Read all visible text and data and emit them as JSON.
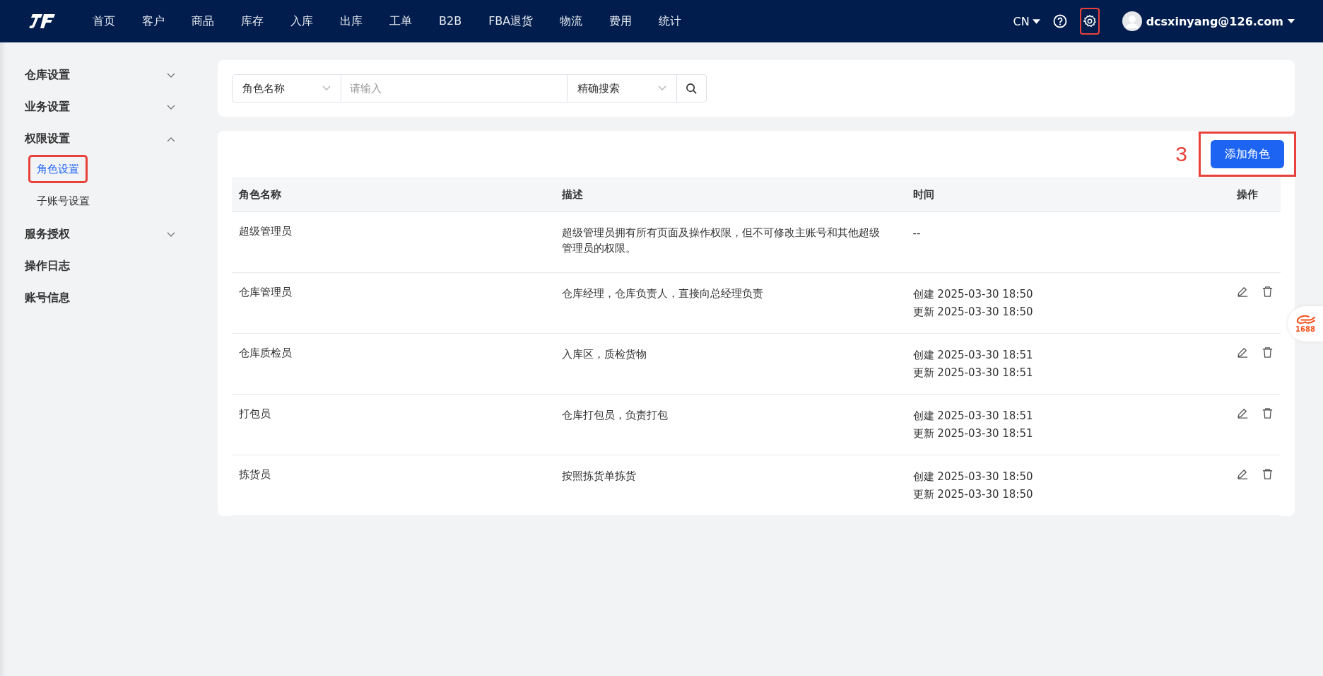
{
  "header": {
    "nav": [
      {
        "label": "首页"
      },
      {
        "label": "客户"
      },
      {
        "label": "商品"
      },
      {
        "label": "库存"
      },
      {
        "label": "入库"
      },
      {
        "label": "出库"
      },
      {
        "label": "工单"
      },
      {
        "label": "B2B"
      },
      {
        "label": "FBA退货"
      },
      {
        "label": "物流"
      },
      {
        "label": "费用"
      },
      {
        "label": "统计"
      }
    ],
    "language": "CN",
    "settings_highlighted": true,
    "user": "dcsxinyang@126.com"
  },
  "sidebar": {
    "items": [
      {
        "label": "仓库设置",
        "expanded": false,
        "has_children": true
      },
      {
        "label": "业务设置",
        "expanded": false,
        "has_children": true
      },
      {
        "label": "权限设置",
        "expanded": true,
        "has_children": true,
        "children": [
          {
            "label": "角色设置",
            "selected": true,
            "highlighted": true
          },
          {
            "label": "子账号设置",
            "selected": false,
            "highlighted": false
          }
        ]
      },
      {
        "label": "服务授权",
        "expanded": false,
        "has_children": true
      },
      {
        "label": "操作日志",
        "has_children": false
      },
      {
        "label": "账号信息",
        "has_children": false
      }
    ]
  },
  "search": {
    "field_select": "角色名称",
    "placeholder": "请输入",
    "mode_select": "精确搜索"
  },
  "toolbar": {
    "annotation": "3",
    "add_button": "添加角色",
    "highlighted": true
  },
  "table": {
    "columns": [
      "角色名称",
      "描述",
      "时间",
      "操作"
    ],
    "rows": [
      {
        "name": "超级管理员",
        "description": "超级管理员拥有所有页面及操作权限，但不可修改主账号和其他超级管理员的权限。",
        "time": [
          "--"
        ],
        "editable": false
      },
      {
        "name": "仓库管理员",
        "description": "仓库经理，仓库负责人，直接向总经理负责",
        "time": [
          "创建 2025-03-30 18:50",
          "更新 2025-03-30 18:50"
        ],
        "editable": true
      },
      {
        "name": "仓库质检员",
        "description": "入库区，质检货物",
        "time": [
          "创建 2025-03-30 18:51",
          "更新 2025-03-30 18:51"
        ],
        "editable": true
      },
      {
        "name": "打包员",
        "description": "仓库打包员，负责打包",
        "time": [
          "创建 2025-03-30 18:51",
          "更新 2025-03-30 18:51"
        ],
        "editable": true
      },
      {
        "name": "拣货员",
        "description": "按照拣货单拣货",
        "time": [
          "创建 2025-03-30 18:50",
          "更新 2025-03-30 18:50"
        ],
        "editable": true
      }
    ]
  },
  "floating_widget": {
    "label": "1688"
  }
}
